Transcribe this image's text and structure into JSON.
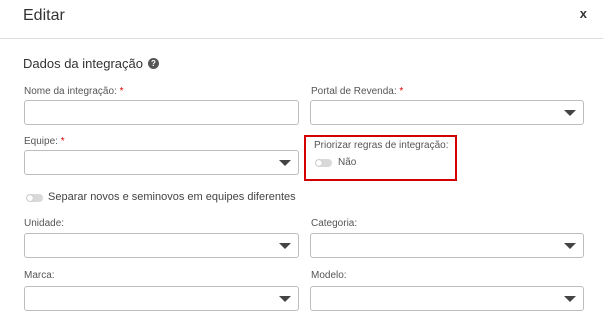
{
  "header": {
    "title": "Editar",
    "close_label": "x"
  },
  "section": {
    "title": "Dados da integração"
  },
  "fields": {
    "nome": {
      "label": "Nome da integração:",
      "required_mark": "*",
      "value": ""
    },
    "portal": {
      "label": "Portal de Revenda:",
      "required_mark": "*",
      "value": ""
    },
    "equipe": {
      "label": "Equipe:",
      "required_mark": "*",
      "value": ""
    },
    "priorizar": {
      "label": "Priorizar regras de integração:",
      "toggle_text": "Não"
    },
    "separar": {
      "toggle_text": "Separar novos e seminovos em equipes diferentes"
    },
    "unidade": {
      "label": "Unidade:",
      "value": ""
    },
    "categoria": {
      "label": "Categoria:",
      "value": ""
    },
    "marca": {
      "label": "Marca:",
      "value": ""
    },
    "modelo": {
      "label": "Modelo:",
      "value": ""
    }
  },
  "colors": {
    "highlight": "#d40000",
    "required": "#dd0000"
  }
}
